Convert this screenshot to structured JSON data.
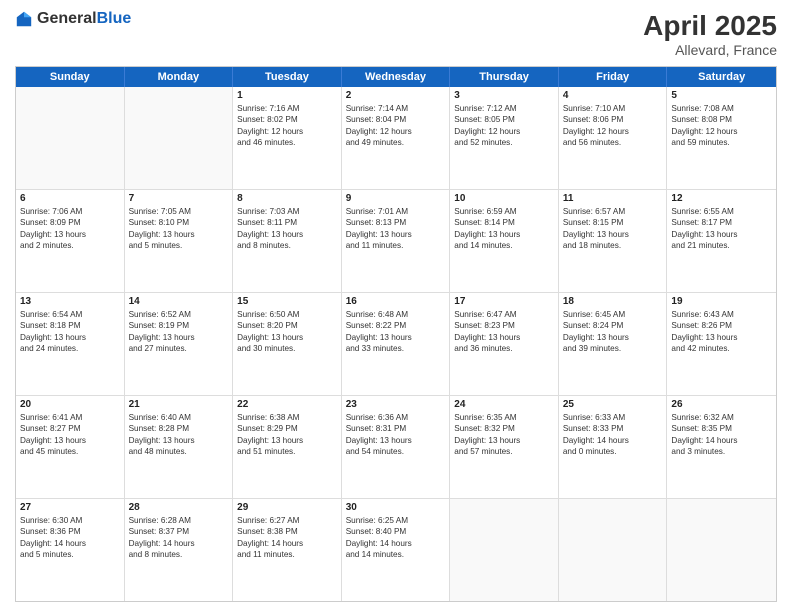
{
  "header": {
    "logo_general": "General",
    "logo_blue": "Blue",
    "title": "April 2025",
    "subtitle": "Allevard, France"
  },
  "calendar": {
    "days_of_week": [
      "Sunday",
      "Monday",
      "Tuesday",
      "Wednesday",
      "Thursday",
      "Friday",
      "Saturday"
    ],
    "weeks": [
      [
        {
          "day": "",
          "lines": []
        },
        {
          "day": "",
          "lines": []
        },
        {
          "day": "1",
          "lines": [
            "Sunrise: 7:16 AM",
            "Sunset: 8:02 PM",
            "Daylight: 12 hours",
            "and 46 minutes."
          ]
        },
        {
          "day": "2",
          "lines": [
            "Sunrise: 7:14 AM",
            "Sunset: 8:04 PM",
            "Daylight: 12 hours",
            "and 49 minutes."
          ]
        },
        {
          "day": "3",
          "lines": [
            "Sunrise: 7:12 AM",
            "Sunset: 8:05 PM",
            "Daylight: 12 hours",
            "and 52 minutes."
          ]
        },
        {
          "day": "4",
          "lines": [
            "Sunrise: 7:10 AM",
            "Sunset: 8:06 PM",
            "Daylight: 12 hours",
            "and 56 minutes."
          ]
        },
        {
          "day": "5",
          "lines": [
            "Sunrise: 7:08 AM",
            "Sunset: 8:08 PM",
            "Daylight: 12 hours",
            "and 59 minutes."
          ]
        }
      ],
      [
        {
          "day": "6",
          "lines": [
            "Sunrise: 7:06 AM",
            "Sunset: 8:09 PM",
            "Daylight: 13 hours",
            "and 2 minutes."
          ]
        },
        {
          "day": "7",
          "lines": [
            "Sunrise: 7:05 AM",
            "Sunset: 8:10 PM",
            "Daylight: 13 hours",
            "and 5 minutes."
          ]
        },
        {
          "day": "8",
          "lines": [
            "Sunrise: 7:03 AM",
            "Sunset: 8:11 PM",
            "Daylight: 13 hours",
            "and 8 minutes."
          ]
        },
        {
          "day": "9",
          "lines": [
            "Sunrise: 7:01 AM",
            "Sunset: 8:13 PM",
            "Daylight: 13 hours",
            "and 11 minutes."
          ]
        },
        {
          "day": "10",
          "lines": [
            "Sunrise: 6:59 AM",
            "Sunset: 8:14 PM",
            "Daylight: 13 hours",
            "and 14 minutes."
          ]
        },
        {
          "day": "11",
          "lines": [
            "Sunrise: 6:57 AM",
            "Sunset: 8:15 PM",
            "Daylight: 13 hours",
            "and 18 minutes."
          ]
        },
        {
          "day": "12",
          "lines": [
            "Sunrise: 6:55 AM",
            "Sunset: 8:17 PM",
            "Daylight: 13 hours",
            "and 21 minutes."
          ]
        }
      ],
      [
        {
          "day": "13",
          "lines": [
            "Sunrise: 6:54 AM",
            "Sunset: 8:18 PM",
            "Daylight: 13 hours",
            "and 24 minutes."
          ]
        },
        {
          "day": "14",
          "lines": [
            "Sunrise: 6:52 AM",
            "Sunset: 8:19 PM",
            "Daylight: 13 hours",
            "and 27 minutes."
          ]
        },
        {
          "day": "15",
          "lines": [
            "Sunrise: 6:50 AM",
            "Sunset: 8:20 PM",
            "Daylight: 13 hours",
            "and 30 minutes."
          ]
        },
        {
          "day": "16",
          "lines": [
            "Sunrise: 6:48 AM",
            "Sunset: 8:22 PM",
            "Daylight: 13 hours",
            "and 33 minutes."
          ]
        },
        {
          "day": "17",
          "lines": [
            "Sunrise: 6:47 AM",
            "Sunset: 8:23 PM",
            "Daylight: 13 hours",
            "and 36 minutes."
          ]
        },
        {
          "day": "18",
          "lines": [
            "Sunrise: 6:45 AM",
            "Sunset: 8:24 PM",
            "Daylight: 13 hours",
            "and 39 minutes."
          ]
        },
        {
          "day": "19",
          "lines": [
            "Sunrise: 6:43 AM",
            "Sunset: 8:26 PM",
            "Daylight: 13 hours",
            "and 42 minutes."
          ]
        }
      ],
      [
        {
          "day": "20",
          "lines": [
            "Sunrise: 6:41 AM",
            "Sunset: 8:27 PM",
            "Daylight: 13 hours",
            "and 45 minutes."
          ]
        },
        {
          "day": "21",
          "lines": [
            "Sunrise: 6:40 AM",
            "Sunset: 8:28 PM",
            "Daylight: 13 hours",
            "and 48 minutes."
          ]
        },
        {
          "day": "22",
          "lines": [
            "Sunrise: 6:38 AM",
            "Sunset: 8:29 PM",
            "Daylight: 13 hours",
            "and 51 minutes."
          ]
        },
        {
          "day": "23",
          "lines": [
            "Sunrise: 6:36 AM",
            "Sunset: 8:31 PM",
            "Daylight: 13 hours",
            "and 54 minutes."
          ]
        },
        {
          "day": "24",
          "lines": [
            "Sunrise: 6:35 AM",
            "Sunset: 8:32 PM",
            "Daylight: 13 hours",
            "and 57 minutes."
          ]
        },
        {
          "day": "25",
          "lines": [
            "Sunrise: 6:33 AM",
            "Sunset: 8:33 PM",
            "Daylight: 14 hours",
            "and 0 minutes."
          ]
        },
        {
          "day": "26",
          "lines": [
            "Sunrise: 6:32 AM",
            "Sunset: 8:35 PM",
            "Daylight: 14 hours",
            "and 3 minutes."
          ]
        }
      ],
      [
        {
          "day": "27",
          "lines": [
            "Sunrise: 6:30 AM",
            "Sunset: 8:36 PM",
            "Daylight: 14 hours",
            "and 5 minutes."
          ]
        },
        {
          "day": "28",
          "lines": [
            "Sunrise: 6:28 AM",
            "Sunset: 8:37 PM",
            "Daylight: 14 hours",
            "and 8 minutes."
          ]
        },
        {
          "day": "29",
          "lines": [
            "Sunrise: 6:27 AM",
            "Sunset: 8:38 PM",
            "Daylight: 14 hours",
            "and 11 minutes."
          ]
        },
        {
          "day": "30",
          "lines": [
            "Sunrise: 6:25 AM",
            "Sunset: 8:40 PM",
            "Daylight: 14 hours",
            "and 14 minutes."
          ]
        },
        {
          "day": "",
          "lines": []
        },
        {
          "day": "",
          "lines": []
        },
        {
          "day": "",
          "lines": []
        }
      ]
    ]
  }
}
